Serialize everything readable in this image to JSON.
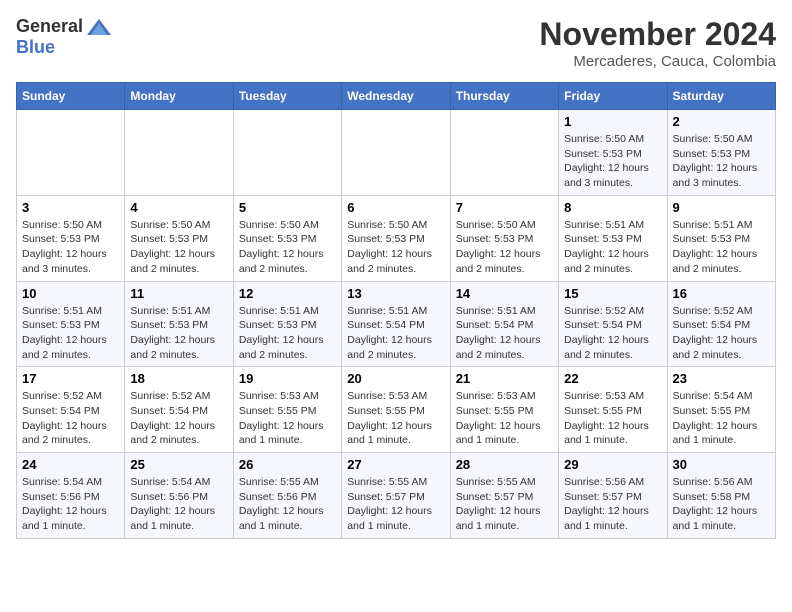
{
  "header": {
    "logo_general": "General",
    "logo_blue": "Blue",
    "month_title": "November 2024",
    "location": "Mercaderes, Cauca, Colombia"
  },
  "weekdays": [
    "Sunday",
    "Monday",
    "Tuesday",
    "Wednesday",
    "Thursday",
    "Friday",
    "Saturday"
  ],
  "weeks": [
    [
      {
        "day": "",
        "info": ""
      },
      {
        "day": "",
        "info": ""
      },
      {
        "day": "",
        "info": ""
      },
      {
        "day": "",
        "info": ""
      },
      {
        "day": "",
        "info": ""
      },
      {
        "day": "1",
        "info": "Sunrise: 5:50 AM\nSunset: 5:53 PM\nDaylight: 12 hours\nand 3 minutes."
      },
      {
        "day": "2",
        "info": "Sunrise: 5:50 AM\nSunset: 5:53 PM\nDaylight: 12 hours\nand 3 minutes."
      }
    ],
    [
      {
        "day": "3",
        "info": "Sunrise: 5:50 AM\nSunset: 5:53 PM\nDaylight: 12 hours\nand 3 minutes."
      },
      {
        "day": "4",
        "info": "Sunrise: 5:50 AM\nSunset: 5:53 PM\nDaylight: 12 hours\nand 2 minutes."
      },
      {
        "day": "5",
        "info": "Sunrise: 5:50 AM\nSunset: 5:53 PM\nDaylight: 12 hours\nand 2 minutes."
      },
      {
        "day": "6",
        "info": "Sunrise: 5:50 AM\nSunset: 5:53 PM\nDaylight: 12 hours\nand 2 minutes."
      },
      {
        "day": "7",
        "info": "Sunrise: 5:50 AM\nSunset: 5:53 PM\nDaylight: 12 hours\nand 2 minutes."
      },
      {
        "day": "8",
        "info": "Sunrise: 5:51 AM\nSunset: 5:53 PM\nDaylight: 12 hours\nand 2 minutes."
      },
      {
        "day": "9",
        "info": "Sunrise: 5:51 AM\nSunset: 5:53 PM\nDaylight: 12 hours\nand 2 minutes."
      }
    ],
    [
      {
        "day": "10",
        "info": "Sunrise: 5:51 AM\nSunset: 5:53 PM\nDaylight: 12 hours\nand 2 minutes."
      },
      {
        "day": "11",
        "info": "Sunrise: 5:51 AM\nSunset: 5:53 PM\nDaylight: 12 hours\nand 2 minutes."
      },
      {
        "day": "12",
        "info": "Sunrise: 5:51 AM\nSunset: 5:53 PM\nDaylight: 12 hours\nand 2 minutes."
      },
      {
        "day": "13",
        "info": "Sunrise: 5:51 AM\nSunset: 5:54 PM\nDaylight: 12 hours\nand 2 minutes."
      },
      {
        "day": "14",
        "info": "Sunrise: 5:51 AM\nSunset: 5:54 PM\nDaylight: 12 hours\nand 2 minutes."
      },
      {
        "day": "15",
        "info": "Sunrise: 5:52 AM\nSunset: 5:54 PM\nDaylight: 12 hours\nand 2 minutes."
      },
      {
        "day": "16",
        "info": "Sunrise: 5:52 AM\nSunset: 5:54 PM\nDaylight: 12 hours\nand 2 minutes."
      }
    ],
    [
      {
        "day": "17",
        "info": "Sunrise: 5:52 AM\nSunset: 5:54 PM\nDaylight: 12 hours\nand 2 minutes."
      },
      {
        "day": "18",
        "info": "Sunrise: 5:52 AM\nSunset: 5:54 PM\nDaylight: 12 hours\nand 2 minutes."
      },
      {
        "day": "19",
        "info": "Sunrise: 5:53 AM\nSunset: 5:55 PM\nDaylight: 12 hours\nand 1 minute."
      },
      {
        "day": "20",
        "info": "Sunrise: 5:53 AM\nSunset: 5:55 PM\nDaylight: 12 hours\nand 1 minute."
      },
      {
        "day": "21",
        "info": "Sunrise: 5:53 AM\nSunset: 5:55 PM\nDaylight: 12 hours\nand 1 minute."
      },
      {
        "day": "22",
        "info": "Sunrise: 5:53 AM\nSunset: 5:55 PM\nDaylight: 12 hours\nand 1 minute."
      },
      {
        "day": "23",
        "info": "Sunrise: 5:54 AM\nSunset: 5:55 PM\nDaylight: 12 hours\nand 1 minute."
      }
    ],
    [
      {
        "day": "24",
        "info": "Sunrise: 5:54 AM\nSunset: 5:56 PM\nDaylight: 12 hours\nand 1 minute."
      },
      {
        "day": "25",
        "info": "Sunrise: 5:54 AM\nSunset: 5:56 PM\nDaylight: 12 hours\nand 1 minute."
      },
      {
        "day": "26",
        "info": "Sunrise: 5:55 AM\nSunset: 5:56 PM\nDaylight: 12 hours\nand 1 minute."
      },
      {
        "day": "27",
        "info": "Sunrise: 5:55 AM\nSunset: 5:57 PM\nDaylight: 12 hours\nand 1 minute."
      },
      {
        "day": "28",
        "info": "Sunrise: 5:55 AM\nSunset: 5:57 PM\nDaylight: 12 hours\nand 1 minute."
      },
      {
        "day": "29",
        "info": "Sunrise: 5:56 AM\nSunset: 5:57 PM\nDaylight: 12 hours\nand 1 minute."
      },
      {
        "day": "30",
        "info": "Sunrise: 5:56 AM\nSunset: 5:58 PM\nDaylight: 12 hours\nand 1 minute."
      }
    ]
  ]
}
